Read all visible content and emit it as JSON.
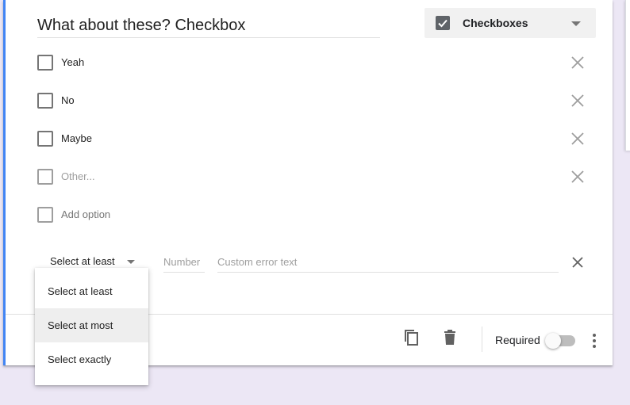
{
  "question": {
    "title": "What about these? Checkbox",
    "type_label": "Checkboxes"
  },
  "options": [
    {
      "label": "Yeah"
    },
    {
      "label": "No"
    },
    {
      "label": "Maybe"
    }
  ],
  "other_placeholder": "Other...",
  "add_option_label": "Add option",
  "validation": {
    "selected": "Select at least",
    "number_placeholder": "Number",
    "error_placeholder": "Custom error text"
  },
  "menu": {
    "items": [
      "Select at least",
      "Select at most",
      "Select exactly"
    ],
    "hovered": "Select at most"
  },
  "footer": {
    "required_label": "Required",
    "required_on": false
  },
  "colors": {
    "accent": "#4285f4",
    "background": "#ece7f5",
    "icon": "#757575"
  }
}
